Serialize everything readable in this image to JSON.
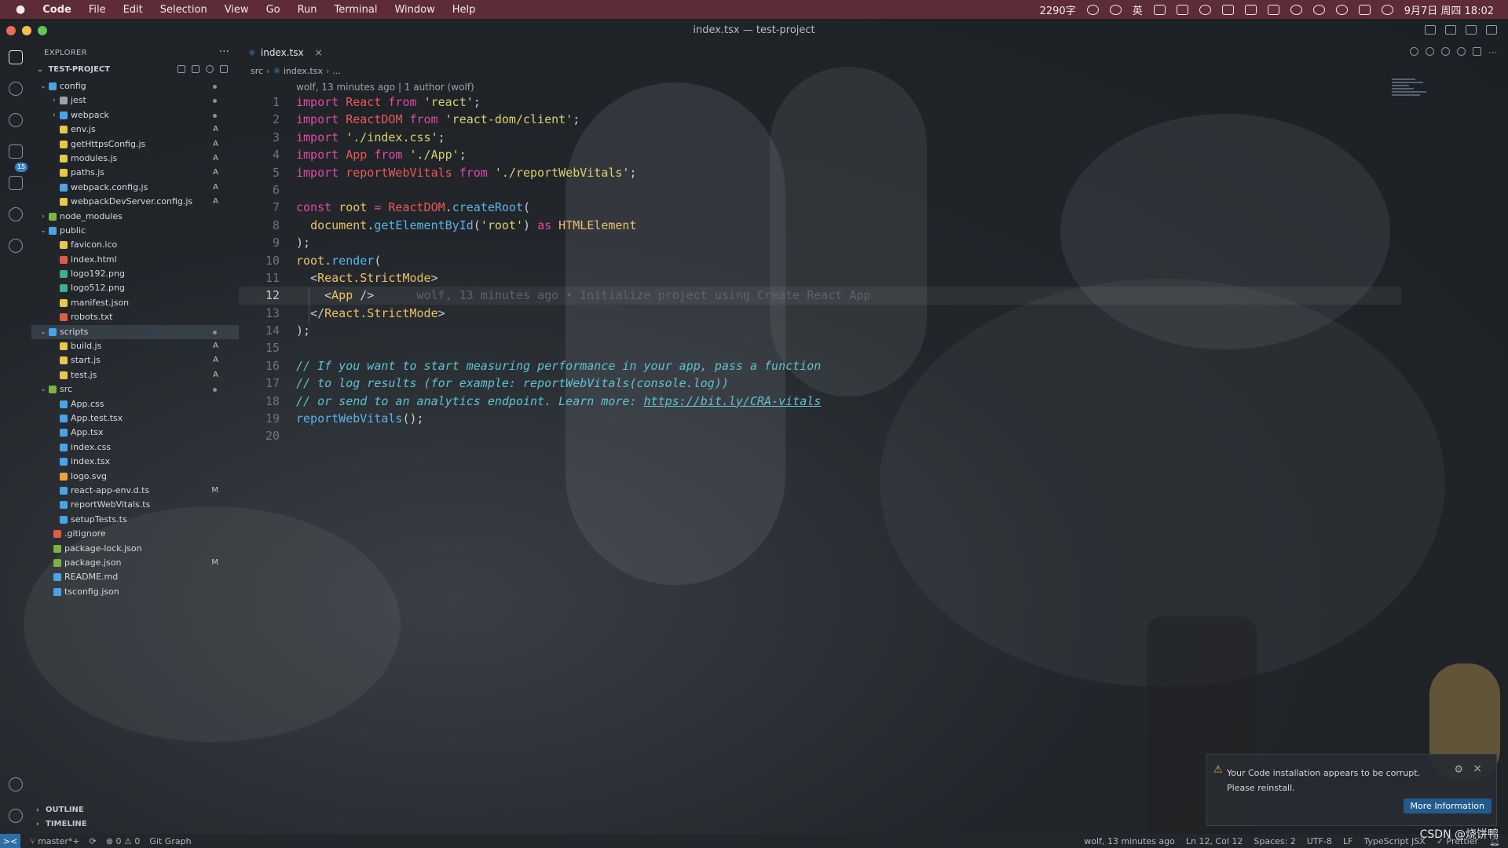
{
  "menubar": {
    "apple": "",
    "app": "Code",
    "items": [
      "File",
      "Edit",
      "Selection",
      "View",
      "Go",
      "Run",
      "Terminal",
      "Window",
      "Help"
    ],
    "word_count": "2290字",
    "ime": "英",
    "datetime": "9月7日 周四 18:02"
  },
  "window": {
    "title": "index.tsx — test-project"
  },
  "activity": {
    "scm_badge": "15"
  },
  "sidebar": {
    "header": "EXPLORER",
    "more": "···",
    "project": "TEST-PROJECT",
    "tree": [
      {
        "label": "config",
        "depth": 0,
        "type": "folder-open",
        "color": "#4aa3e6",
        "status": "dot"
      },
      {
        "label": "jest",
        "depth": 1,
        "type": "folder",
        "color": "#9aa3ad",
        "status": "dot"
      },
      {
        "label": "webpack",
        "depth": 1,
        "type": "folder",
        "color": "#4aa3e6",
        "status": "dot"
      },
      {
        "label": "env.js",
        "depth": 1,
        "type": "file",
        "color": "#e6c84a",
        "status": "A"
      },
      {
        "label": "getHttpsConfig.js",
        "depth": 1,
        "type": "file",
        "color": "#e6c84a",
        "status": "A"
      },
      {
        "label": "modules.js",
        "depth": 1,
        "type": "file",
        "color": "#e6c84a",
        "status": "A"
      },
      {
        "label": "paths.js",
        "depth": 1,
        "type": "file",
        "color": "#e6c84a",
        "status": "A"
      },
      {
        "label": "webpack.config.js",
        "depth": 1,
        "type": "file",
        "color": "#4aa3e6",
        "status": "A"
      },
      {
        "label": "webpackDevServer.config.js",
        "depth": 1,
        "type": "file",
        "color": "#e6c84a",
        "status": "A"
      },
      {
        "label": "node_modules",
        "depth": 0,
        "type": "folder",
        "color": "#7cb342",
        "status": ""
      },
      {
        "label": "public",
        "depth": 0,
        "type": "folder-open",
        "color": "#4aa3e6",
        "status": ""
      },
      {
        "label": "favicon.ico",
        "depth": 1,
        "type": "file",
        "color": "#e6c84a",
        "status": ""
      },
      {
        "label": "index.html",
        "depth": 1,
        "type": "file",
        "color": "#e05a4a",
        "status": ""
      },
      {
        "label": "logo192.png",
        "depth": 1,
        "type": "file",
        "color": "#3fae8c",
        "status": ""
      },
      {
        "label": "logo512.png",
        "depth": 1,
        "type": "file",
        "color": "#3fae8c",
        "status": ""
      },
      {
        "label": "manifest.json",
        "depth": 1,
        "type": "file",
        "color": "#e6c84a",
        "status": ""
      },
      {
        "label": "robots.txt",
        "depth": 1,
        "type": "file",
        "color": "#e05a4a",
        "status": ""
      },
      {
        "label": "scripts",
        "depth": 0,
        "type": "folder-open",
        "color": "#4aa3e6",
        "status": "dot",
        "selected": true
      },
      {
        "label": "build.js",
        "depth": 1,
        "type": "file",
        "color": "#e6c84a",
        "status": "A"
      },
      {
        "label": "start.js",
        "depth": 1,
        "type": "file",
        "color": "#e6c84a",
        "status": "A"
      },
      {
        "label": "test.js",
        "depth": 1,
        "type": "file",
        "color": "#e6c84a",
        "status": "A"
      },
      {
        "label": "src",
        "depth": 0,
        "type": "folder-open",
        "color": "#7cb342",
        "status": "dot"
      },
      {
        "label": "App.css",
        "depth": 1,
        "type": "file",
        "color": "#4aa3e6",
        "status": ""
      },
      {
        "label": "App.test.tsx",
        "depth": 1,
        "type": "file",
        "color": "#4aa3e6",
        "status": ""
      },
      {
        "label": "App.tsx",
        "depth": 1,
        "type": "file",
        "color": "#4aa3e6",
        "status": ""
      },
      {
        "label": "index.css",
        "depth": 1,
        "type": "file",
        "color": "#4aa3e6",
        "status": ""
      },
      {
        "label": "index.tsx",
        "depth": 1,
        "type": "file",
        "color": "#4aa3e6",
        "status": ""
      },
      {
        "label": "logo.svg",
        "depth": 1,
        "type": "file",
        "color": "#e6a53f",
        "status": ""
      },
      {
        "label": "react-app-env.d.ts",
        "depth": 1,
        "type": "file",
        "color": "#4aa3e6",
        "status": "M"
      },
      {
        "label": "reportWebVitals.ts",
        "depth": 1,
        "type": "file",
        "color": "#4aa3e6",
        "status": ""
      },
      {
        "label": "setupTests.ts",
        "depth": 1,
        "type": "file",
        "color": "#4aa3e6",
        "status": ""
      },
      {
        "label": ".gitignore",
        "depth": -1,
        "type": "file",
        "color": "#e05a4a",
        "status": ""
      },
      {
        "label": "package-lock.json",
        "depth": -1,
        "type": "file",
        "color": "#7cb342",
        "status": ""
      },
      {
        "label": "package.json",
        "depth": -1,
        "type": "file",
        "color": "#7cb342",
        "status": "M"
      },
      {
        "label": "README.md",
        "depth": -1,
        "type": "file",
        "color": "#4aa3e6",
        "status": ""
      },
      {
        "label": "tsconfig.json",
        "depth": -1,
        "type": "file",
        "color": "#4aa3e6",
        "status": ""
      }
    ],
    "outline": "OUTLINE",
    "timeline": "TIMELINE"
  },
  "editor": {
    "tab": {
      "label": "index.tsx",
      "close": "×"
    },
    "breadcrumb": [
      "src",
      "index.tsx",
      "..."
    ],
    "blame_header": "wolf, 13 minutes ago | 1 author (wolf)",
    "current_line": 12,
    "lines": [
      [
        [
          "kw",
          "import "
        ],
        [
          "var",
          "React "
        ],
        [
          "kw",
          "from "
        ],
        [
          "str",
          "'react'"
        ],
        [
          "pn",
          ";"
        ]
      ],
      [
        [
          "kw",
          "import "
        ],
        [
          "var",
          "ReactDOM "
        ],
        [
          "kw",
          "from "
        ],
        [
          "str",
          "'react-dom/client'"
        ],
        [
          "pn",
          ";"
        ]
      ],
      [
        [
          "kw",
          "import "
        ],
        [
          "str",
          "'./index.css'"
        ],
        [
          "pn",
          ";"
        ]
      ],
      [
        [
          "kw",
          "import "
        ],
        [
          "var",
          "App "
        ],
        [
          "kw",
          "from "
        ],
        [
          "str",
          "'./App'"
        ],
        [
          "pn",
          ";"
        ]
      ],
      [
        [
          "kw",
          "import "
        ],
        [
          "var",
          "reportWebVitals "
        ],
        [
          "kw",
          "from "
        ],
        [
          "str",
          "'./reportWebVitals'"
        ],
        [
          "pn",
          ";"
        ]
      ],
      [],
      [
        [
          "kw",
          "const "
        ],
        [
          "typ",
          "root "
        ],
        [
          "kw",
          "= "
        ],
        [
          "var",
          "ReactDOM"
        ],
        [
          "pn",
          "."
        ],
        [
          "fn",
          "createRoot"
        ],
        [
          "pn",
          "("
        ]
      ],
      [
        [
          "pn",
          "  "
        ],
        [
          "typ",
          "document"
        ],
        [
          "pn",
          "."
        ],
        [
          "fn",
          "getElementById"
        ],
        [
          "pn",
          "("
        ],
        [
          "str",
          "'root'"
        ],
        [
          "pn",
          ") "
        ],
        [
          "kw",
          "as "
        ],
        [
          "typ",
          "HTMLElement"
        ]
      ],
      [
        [
          "pn",
          ");"
        ]
      ],
      [
        [
          "typ",
          "root"
        ],
        [
          "pn",
          "."
        ],
        [
          "fn",
          "render"
        ],
        [
          "pn",
          "("
        ]
      ],
      [
        [
          "pn",
          "  <"
        ],
        [
          "typ",
          "React.StrictMode"
        ],
        [
          "pn",
          ">"
        ]
      ],
      [
        [
          "pn",
          "    <"
        ],
        [
          "typ",
          "App "
        ],
        [
          "pn",
          "/>"
        ],
        [
          "inline-blame",
          "      wolf, 13 minutes ago • Initialize project using Create React App"
        ]
      ],
      [
        [
          "pn",
          "  </"
        ],
        [
          "typ",
          "React.StrictMode"
        ],
        [
          "pn",
          ">"
        ]
      ],
      [
        [
          "pn",
          ");"
        ]
      ],
      [],
      [
        [
          "cm",
          "// If you want to start measuring performance in your app, pass a function"
        ]
      ],
      [
        [
          "cm",
          "// to log results (for example: reportWebVitals(console.log))"
        ]
      ],
      [
        [
          "cm",
          "// or send to an analytics endpoint. Learn more: "
        ],
        [
          "lnk",
          "https://bit.ly/CRA-vitals"
        ]
      ],
      [
        [
          "fn",
          "reportWebVitals"
        ],
        [
          "pn",
          "();"
        ]
      ],
      []
    ]
  },
  "notification": {
    "message": "Your Code installation appears to be corrupt. Please reinstall.",
    "button": "More Information",
    "close": "×"
  },
  "statusbar": {
    "remote": "><",
    "branch": "master*+",
    "problems": "⊗ 0 ⚠ 0",
    "git_graph": "Git Graph",
    "blame": "wolf, 13 minutes ago",
    "position": "Ln 12, Col 12",
    "spaces": "Spaces: 2",
    "encoding": "UTF-8",
    "eol": "LF",
    "language": "TypeScript JSX",
    "prettier": "✓ Prettier"
  },
  "watermark": "CSDN @烧饼鸭"
}
